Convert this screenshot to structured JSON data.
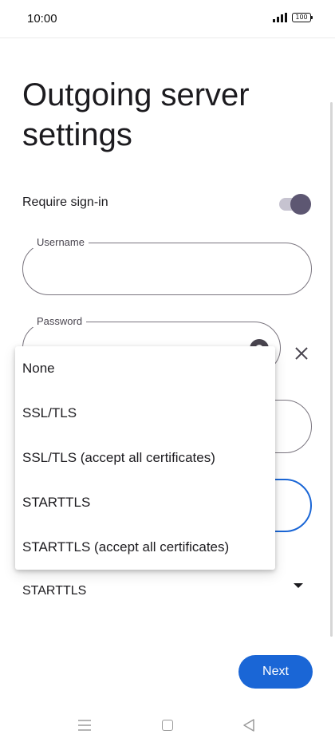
{
  "status_bar": {
    "time": "10:00",
    "battery": "100"
  },
  "page": {
    "title": "Outgoing server settings"
  },
  "require_signin": {
    "label": "Require sign-in",
    "enabled": true
  },
  "username": {
    "label": "Username",
    "value": ""
  },
  "password": {
    "label": "Password",
    "value": ""
  },
  "security": {
    "selected": "STARTTLS",
    "options": [
      "None",
      "SSL/TLS",
      "SSL/TLS (accept all certificates)",
      "STARTTLS",
      "STARTTLS (accept all certificates)"
    ]
  },
  "footer": {
    "next_label": "Next"
  },
  "icons": {
    "signal": "signal-icon",
    "battery": "battery-icon",
    "eye": "eye-icon",
    "clear": "close-icon",
    "dropdown": "chevron-down-icon",
    "nav_menu": "menu-icon",
    "nav_home": "home-icon",
    "nav_back": "back-icon"
  },
  "colors": {
    "accent": "#1a66d6",
    "toggle_thumb": "#5d5772",
    "toggle_track": "#c6c3d0",
    "outline": "#79747e"
  }
}
